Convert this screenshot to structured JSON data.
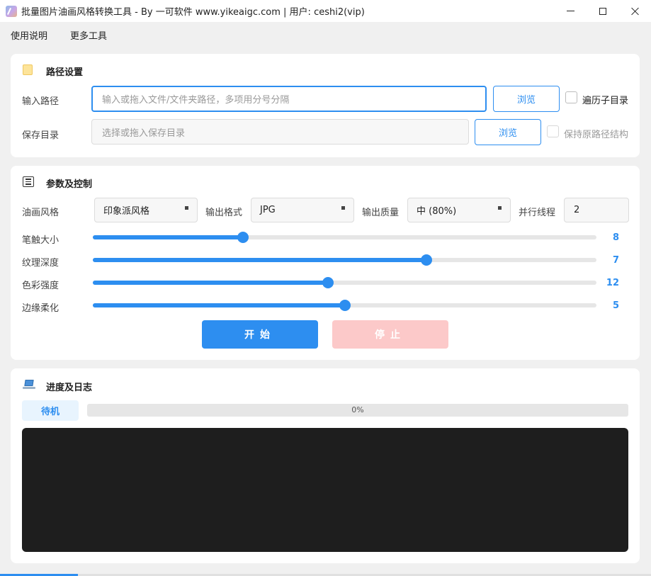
{
  "window": {
    "title": "批量图片油画风格转换工具 - By 一可软件 www.yikeaigc.com  |  用户: ceshi2(vip)",
    "icons": {
      "app": "app-icon",
      "minimize": "minimize-icon",
      "maximize": "maximize-icon",
      "close": "close-icon"
    }
  },
  "menu": {
    "usage": "使用说明",
    "tools": "更多工具"
  },
  "path_card": {
    "title": "路径设置",
    "icon": "folder-icon",
    "input_label": "输入路径",
    "input_placeholder": "输入或拖入文件/文件夹路径，多项用分号分隔",
    "input_value": "",
    "browse_input": "浏览",
    "recurse_label": "遍历子目录",
    "recurse_checked": false,
    "save_label": "保存目录",
    "save_placeholder": "选择或拖入保存目录",
    "save_value": "",
    "browse_save": "浏览",
    "keep_structure_label": "保持原路径结构",
    "keep_structure_checked": false,
    "keep_structure_enabled": false
  },
  "params_card": {
    "title": "参数及控制",
    "icon": "list-icon",
    "style_label": "油画风格",
    "style_value": "印象派风格",
    "format_label": "输出格式",
    "format_value": "JPG",
    "quality_label": "输出质量",
    "quality_value": "中 (80%)",
    "threads_label": "并行线程",
    "threads_value": "2",
    "sliders": [
      {
        "label": "笔触大小",
        "value": "8",
        "fraction": 0.298
      },
      {
        "label": "纹理深度",
        "value": "7",
        "fraction": 0.663
      },
      {
        "label": "色彩强度",
        "value": "12",
        "fraction": 0.467
      },
      {
        "label": "边缘柔化",
        "value": "5",
        "fraction": 0.501
      }
    ],
    "start_button": "开始",
    "stop_button": "停止"
  },
  "log_card": {
    "title": "进度及日志",
    "icon": "laptop-icon",
    "status": "待机",
    "progress_percent": 0,
    "progress_text": "0%"
  },
  "colors": {
    "accent": "#2d8ef0",
    "stop_disabled": "#fcc9c9",
    "log_background": "#1e1e1e"
  }
}
